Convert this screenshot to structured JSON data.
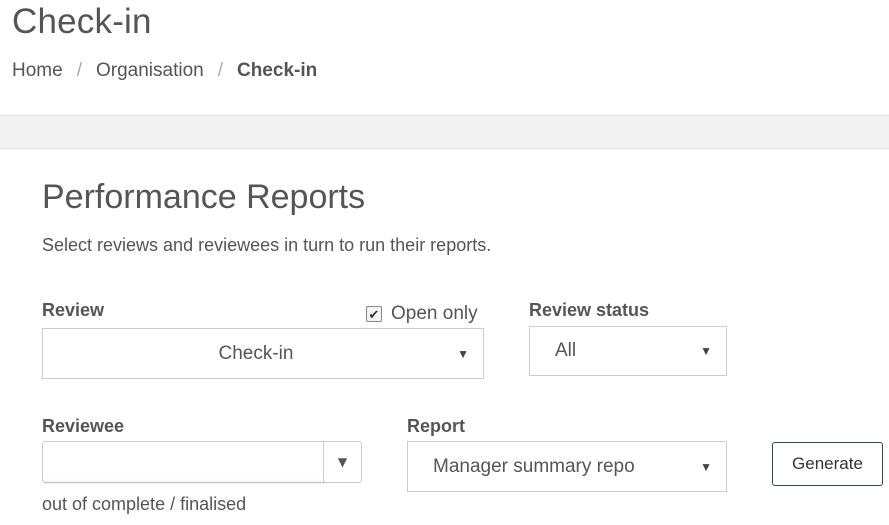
{
  "header": {
    "title": "Check-in",
    "breadcrumb": {
      "home": "Home",
      "separator": "/",
      "organisation": "Organisation",
      "current": "Check-in"
    }
  },
  "reports": {
    "title": "Performance Reports",
    "description": "Select reviews and reviewees in turn to run their reports.",
    "review": {
      "label": "Review",
      "selected": "Check-in",
      "open_only_label": "Open only",
      "open_only_checked": true
    },
    "review_status": {
      "label": "Review status",
      "selected": "All"
    },
    "reviewee": {
      "label": "Reviewee",
      "value": ""
    },
    "report": {
      "label": "Report",
      "selected": "Manager summary repo"
    },
    "progress_text": "out of complete / finalised",
    "generate_label": "Generate"
  },
  "icons": {
    "dropdown_arrow": "▼",
    "checkmark": "✔"
  }
}
